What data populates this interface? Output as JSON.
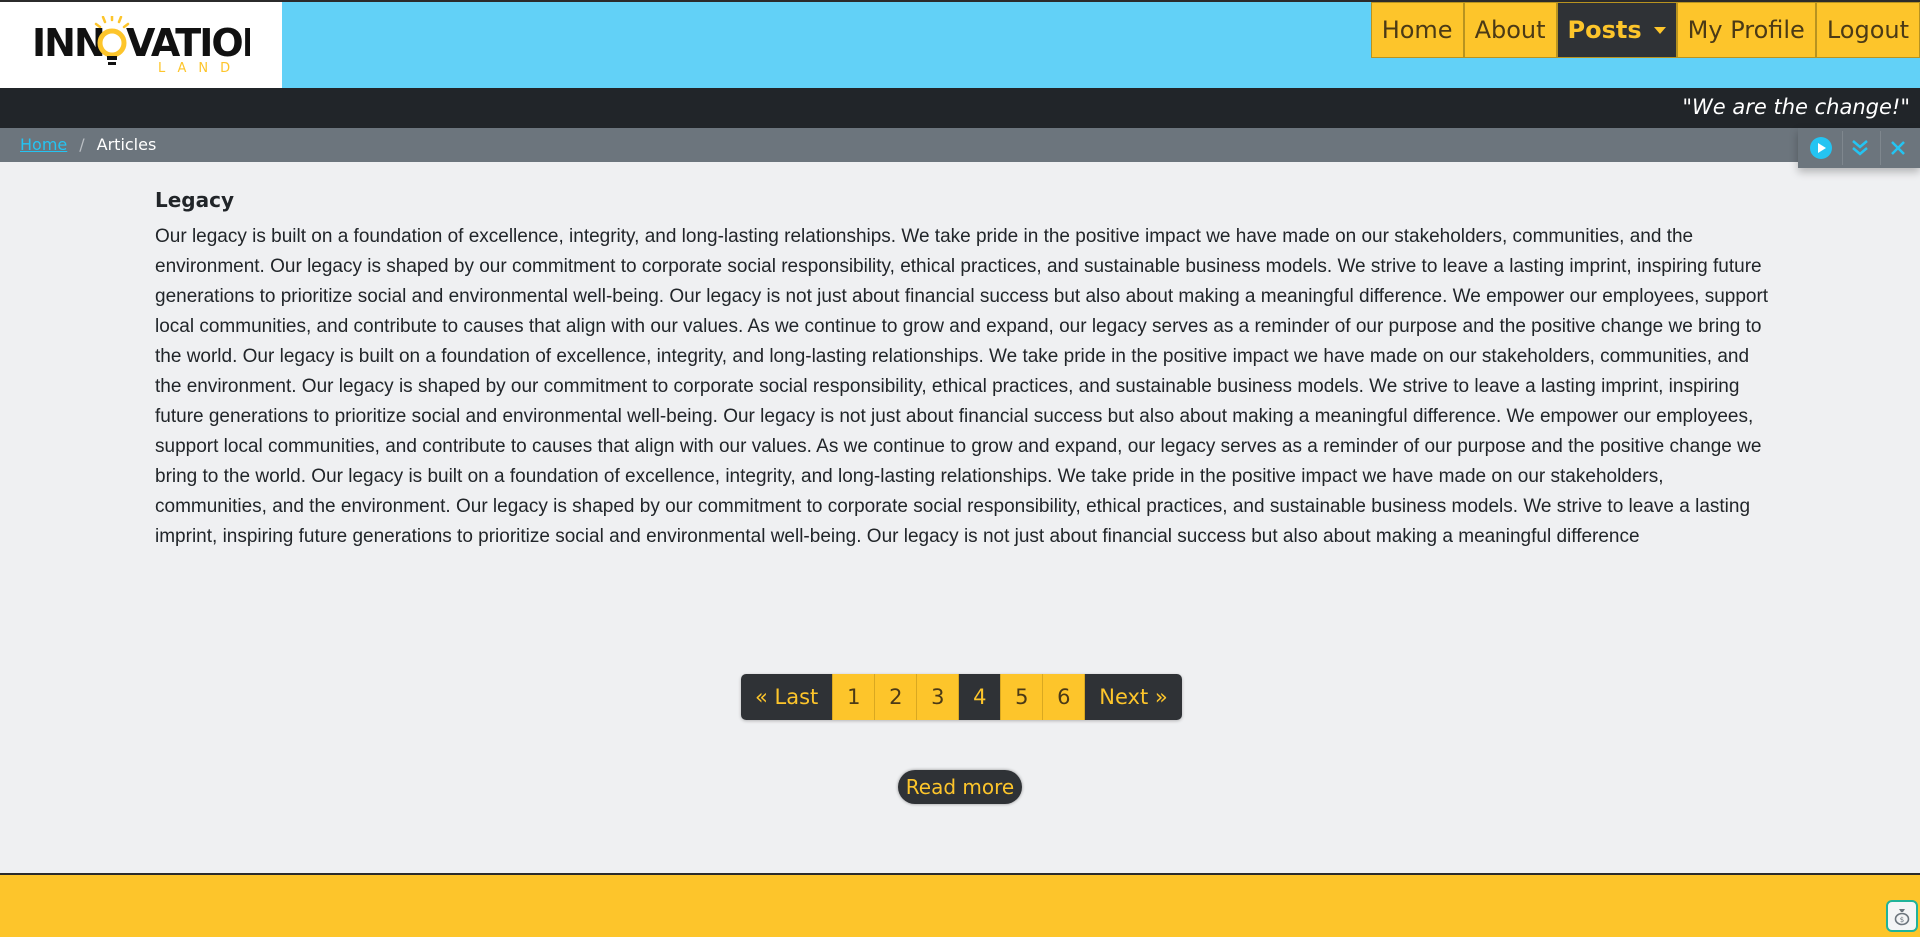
{
  "logo": {
    "main": "INNOVATION",
    "sub": "LAND"
  },
  "nav": {
    "items": [
      {
        "label": "Home"
      },
      {
        "label": "About"
      },
      {
        "label": "Posts"
      },
      {
        "label": "My Profile"
      },
      {
        "label": "Logout"
      }
    ],
    "active_index": 2
  },
  "slogan": "\"We are the change!\"",
  "breadcrumb": {
    "home": "Home",
    "current": "Articles",
    "separator": "/"
  },
  "controls": {
    "icons": [
      "play-icon",
      "double-chevron-down-icon",
      "close-icon"
    ]
  },
  "article": {
    "title": "Legacy",
    "body": "Our legacy is built on a foundation of excellence, integrity, and long-lasting relationships. We take pride in the positive impact we have made on our stakeholders, communities, and the environment. Our legacy is shaped by our commitment to corporate social responsibility, ethical practices, and sustainable business models. We strive to leave a lasting imprint, inspiring future generations to prioritize social and environmental well-being. Our legacy is not just about financial success but also about making a meaningful difference. We empower our employees, support local communities, and contribute to causes that align with our values. As we continue to grow and expand, our legacy serves as a reminder of our purpose and the positive change we bring to the world. Our legacy is built on a foundation of excellence, integrity, and long-lasting relationships. We take pride in the positive impact we have made on our stakeholders, communities, and the environment. Our legacy is shaped by our commitment to corporate social responsibility, ethical practices, and sustainable business models. We strive to leave a lasting imprint, inspiring future generations to prioritize social and environmental well-being. Our legacy is not just about financial success but also about making a meaningful difference. We empower our employees, support local communities, and contribute to causes that align with our values. As we continue to grow and expand, our legacy serves as a reminder of our purpose and the positive change we bring to the world. Our legacy is built on a foundation of excellence, integrity, and long-lasting relationships. We take pride in the positive impact we have made on our stakeholders, communities, and the environment. Our legacy is shaped by our commitment to corporate social responsibility, ethical practices, and sustainable business models. We strive to leave a lasting imprint, inspiring future generations to prioritize social and environmental well-being. Our legacy is not just about financial success but also about making a meaningful difference"
  },
  "pagination": {
    "prev_label": "« Last",
    "next_label": "Next »",
    "pages": [
      "1",
      "2",
      "3",
      "4",
      "5",
      "6"
    ],
    "current_page": "4"
  },
  "read_more": "Read more",
  "colors": {
    "accent_yellow": "#fdc52b",
    "header_blue": "#62d1f7",
    "dark": "#212529",
    "gray_bar": "#6c757d"
  }
}
